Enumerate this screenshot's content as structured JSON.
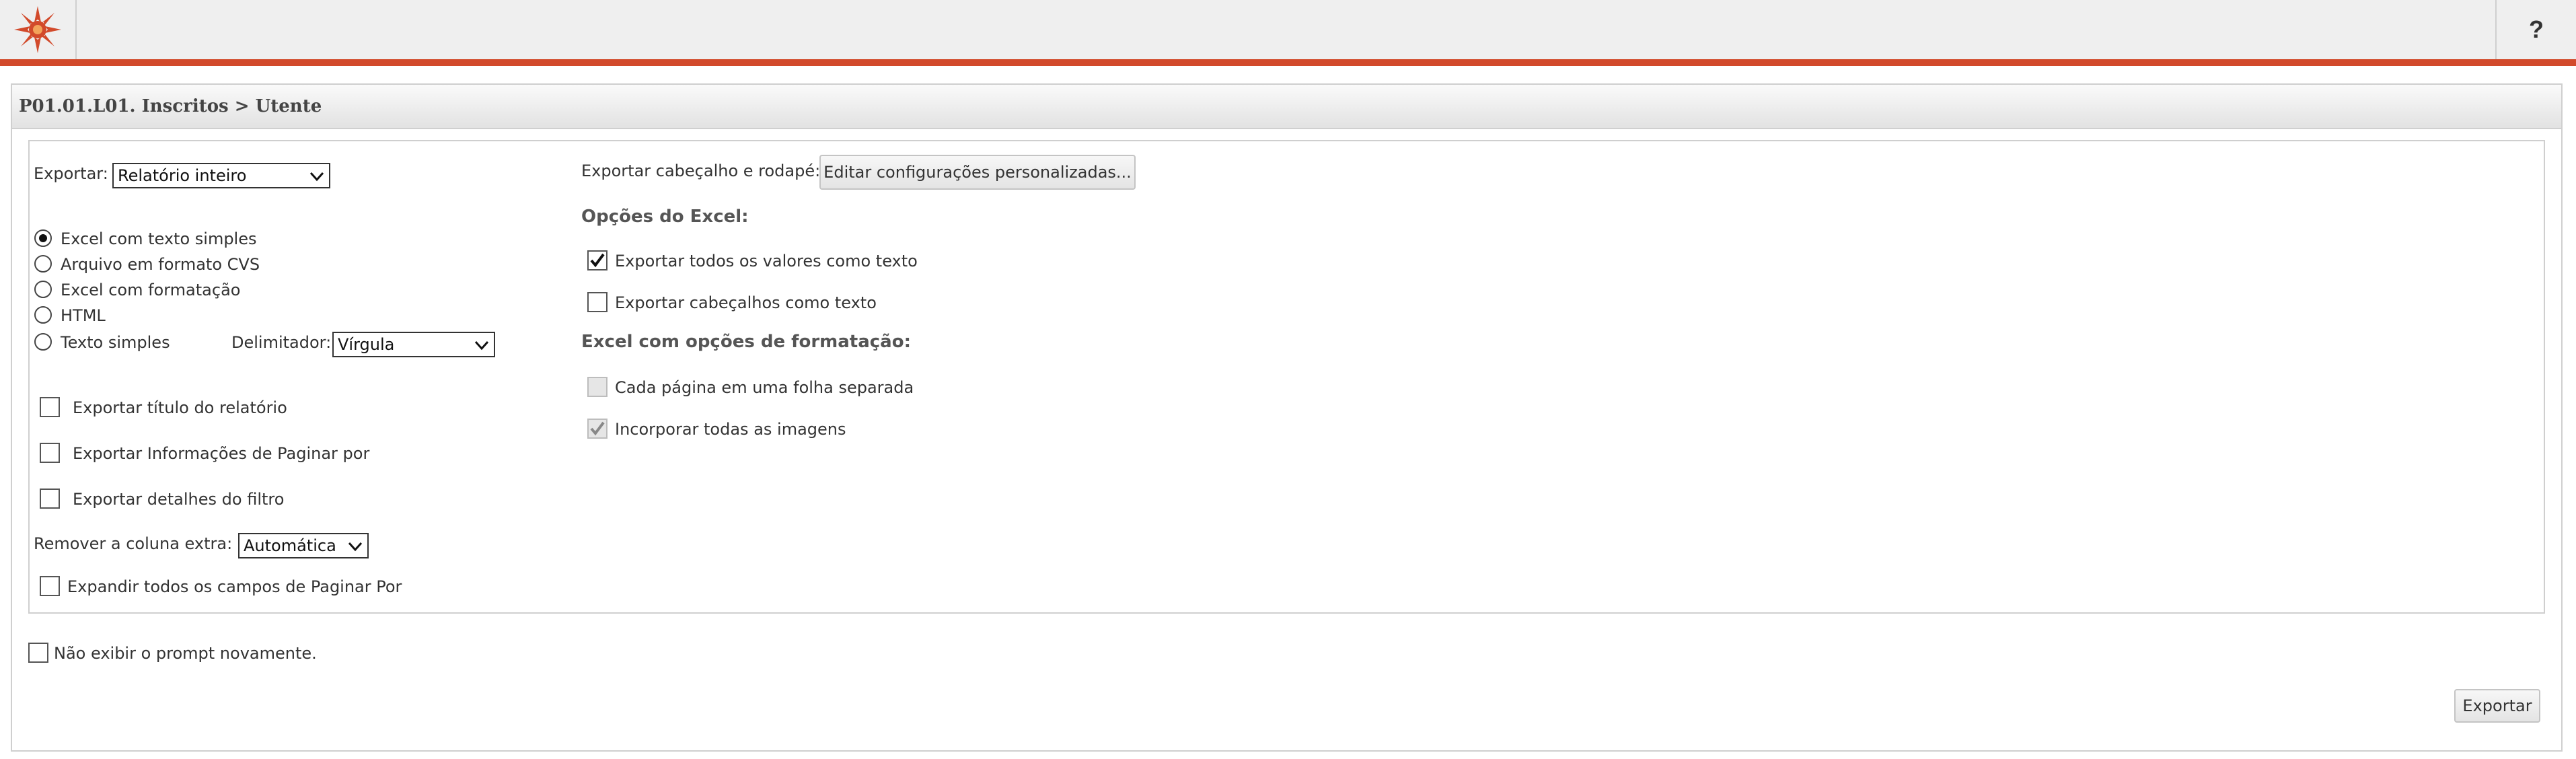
{
  "header": {
    "help_label": "?"
  },
  "panel": {
    "title": "P01.01.L01. Inscritos > Utente"
  },
  "export": {
    "label": "Exportar:",
    "selected": "Relatório inteiro",
    "formats": [
      {
        "label": "Excel com texto simples",
        "selected": true
      },
      {
        "label": "Arquivo em formato CVS",
        "selected": false
      },
      {
        "label": "Excel com formatação",
        "selected": false
      },
      {
        "label": "HTML",
        "selected": false
      },
      {
        "label": "Texto simples",
        "selected": false
      }
    ],
    "delimiter_label": "Delimitador:",
    "delimiter_value": "Vírgula"
  },
  "options": {
    "export_title": {
      "label": "Exportar título do relatório",
      "checked": false
    },
    "export_page_info": {
      "label": "Exportar Informações de Paginar por",
      "checked": false
    },
    "export_filter": {
      "label": "Exportar detalhes do filtro",
      "checked": false
    },
    "remove_column_label": "Remover a coluna extra:",
    "remove_column_value": "Automática",
    "expand_all": {
      "label": "Expandir todos os campos de Paginar Por",
      "checked": false
    }
  },
  "header_footer": {
    "label": "Exportar cabeçalho e rodapé:",
    "button": "Editar configurações personalizadas..."
  },
  "excel_options": {
    "title": "Opções do Excel:",
    "all_as_text": {
      "label": "Exportar todos os valores como texto",
      "checked": true
    },
    "headers_as_text": {
      "label": "Exportar cabeçalhos como texto",
      "checked": false
    }
  },
  "excel_format_options": {
    "title": "Excel com opções de formatação:",
    "separate_sheets": {
      "label": "Cada página em uma folha separada",
      "checked": false,
      "disabled": true
    },
    "embed_images": {
      "label": "Incorporar todas as imagens",
      "checked": true,
      "disabled": true
    }
  },
  "footer": {
    "dont_show_label": "Não exibir o prompt novamente.",
    "export_button": "Exportar"
  }
}
